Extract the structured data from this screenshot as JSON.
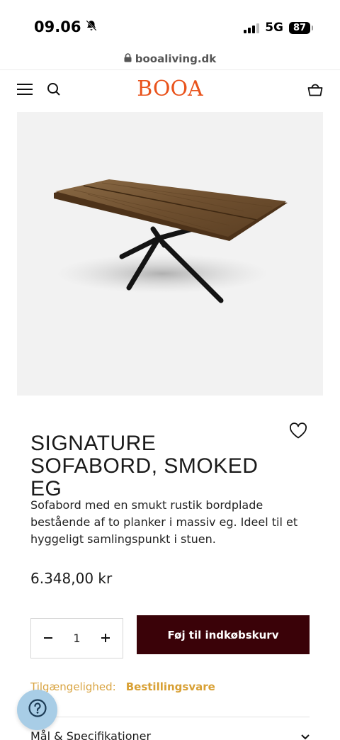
{
  "status_bar": {
    "time": "09.06",
    "network": "5G",
    "battery": "87"
  },
  "browser": {
    "url": "booaliving.dk"
  },
  "header": {
    "logo": "BOOA",
    "icons": [
      "menu-icon",
      "search-icon",
      "cart-icon"
    ]
  },
  "product": {
    "title": "SIGNATURE SOFABORD, SMOKED EG",
    "description": "Sofabord med en smukt rustik bordplade bestående af to planker i massiv eg. Ideel til et hyggeligt samlingspunkt i stuen.",
    "price": "6.348,00 kr",
    "quantity": "1",
    "add_to_cart_label": "Føj til indkøbskurv",
    "availability_label": "Tilgængelighed:",
    "availability_value": "Bestillingsvare",
    "accordion_label": "Mål & Specifikationer"
  },
  "colors": {
    "brand": "#e9541d",
    "button": "#3a0208",
    "availability": "#d9a441",
    "help_button": "#a8cde6"
  }
}
